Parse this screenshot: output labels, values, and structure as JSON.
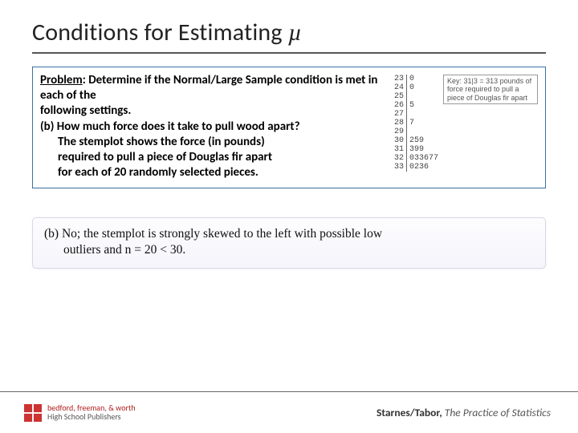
{
  "title": {
    "text": "Conditions for Estimating ",
    "symbol": "µ"
  },
  "problem": {
    "label": "Problem",
    "intro": ": Determine if the Normal/Large Sample condition is met in each of the ",
    "following": "following settings.",
    "part_b_q": "(b) How much force does it take to pull wood apart?",
    "detail1": "The stemplot shows the force (in pounds)",
    "detail2": "required to pull a piece of Douglas fir apart",
    "detail3": "for each of 20 randomly selected pieces."
  },
  "stemplot": {
    "stems": [
      "23",
      "24",
      "25",
      "26",
      "27",
      "28",
      "29",
      "30",
      "31",
      "32",
      "33"
    ],
    "leaves": [
      "0",
      "0",
      "",
      "5",
      "",
      "7",
      "",
      "259",
      "399",
      "033677",
      "0236"
    ],
    "key": "Key: 31|3 = 313 pounds of force required to pull a piece of Douglas fir apart"
  },
  "answer": {
    "line1": "(b) No; the stemplot is strongly skewed to the left with possible low",
    "line2": "outliers and n = 20 < 30."
  },
  "footer": {
    "pub_line1": "bedford, freeman, & worth",
    "pub_line2": "High School Publishers",
    "authors": "Starnes/Tabor,",
    "book": " The Practice of Statistics"
  }
}
